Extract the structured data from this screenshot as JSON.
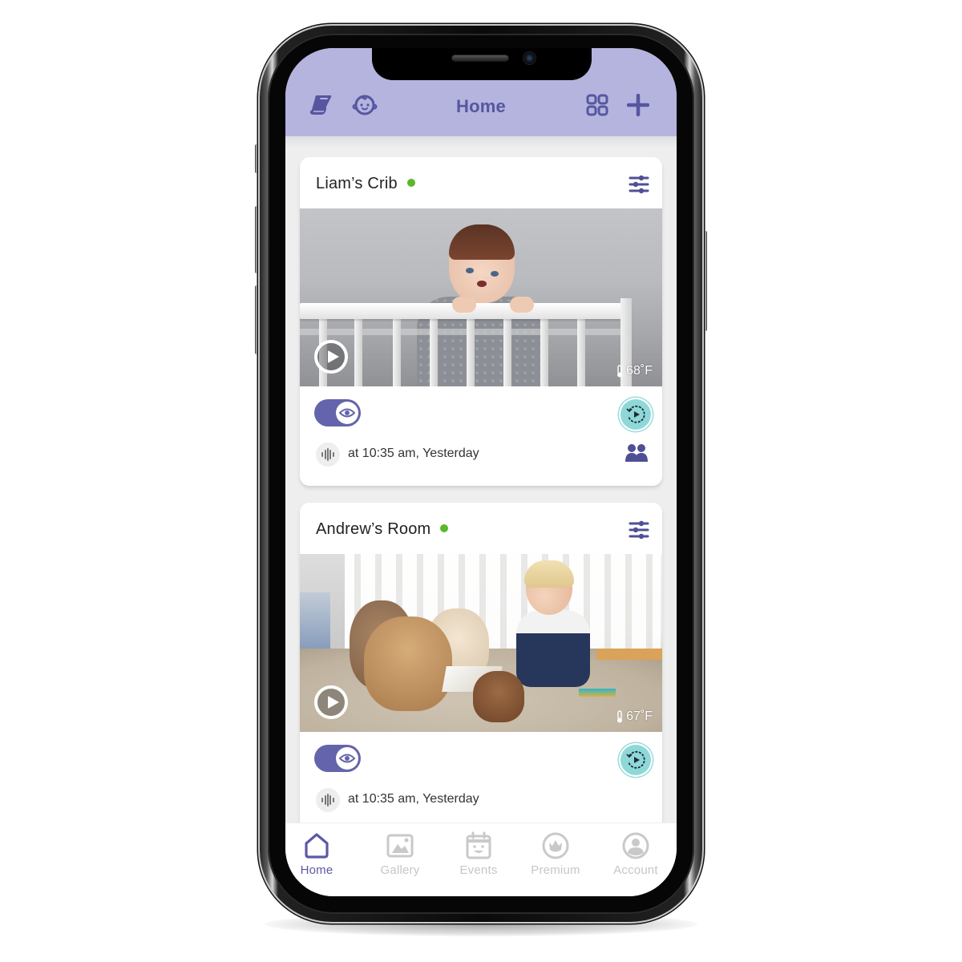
{
  "header": {
    "title": "Home",
    "left_icons": [
      "book-icon",
      "baby-face-icon"
    ],
    "right_icons": [
      "grid-view-icon",
      "add-icon"
    ],
    "background_color": "#b4b4de",
    "accent_color": "#5656a0"
  },
  "cameras": [
    {
      "name": "Liam’s Crib",
      "online": true,
      "status_color": "#5ab82a",
      "temperature": "68˚F",
      "monitoring_on": true,
      "last_event": "at 10:35 am, Yesterday",
      "shared": true
    },
    {
      "name": "Andrew’s Room",
      "online": true,
      "status_color": "#5ab82a",
      "temperature": "67˚F",
      "monitoring_on": true,
      "last_event": "at 10:35 am, Yesterday",
      "shared": false
    }
  ],
  "bottom_nav": {
    "items": [
      {
        "label": "Home",
        "icon": "home-icon",
        "active": true
      },
      {
        "label": "Gallery",
        "icon": "gallery-icon",
        "active": false
      },
      {
        "label": "Events",
        "icon": "calendar-icon",
        "active": false
      },
      {
        "label": "Premium",
        "icon": "premium-crown-icon",
        "active": false
      },
      {
        "label": "Account",
        "icon": "account-icon",
        "active": false
      }
    ]
  }
}
